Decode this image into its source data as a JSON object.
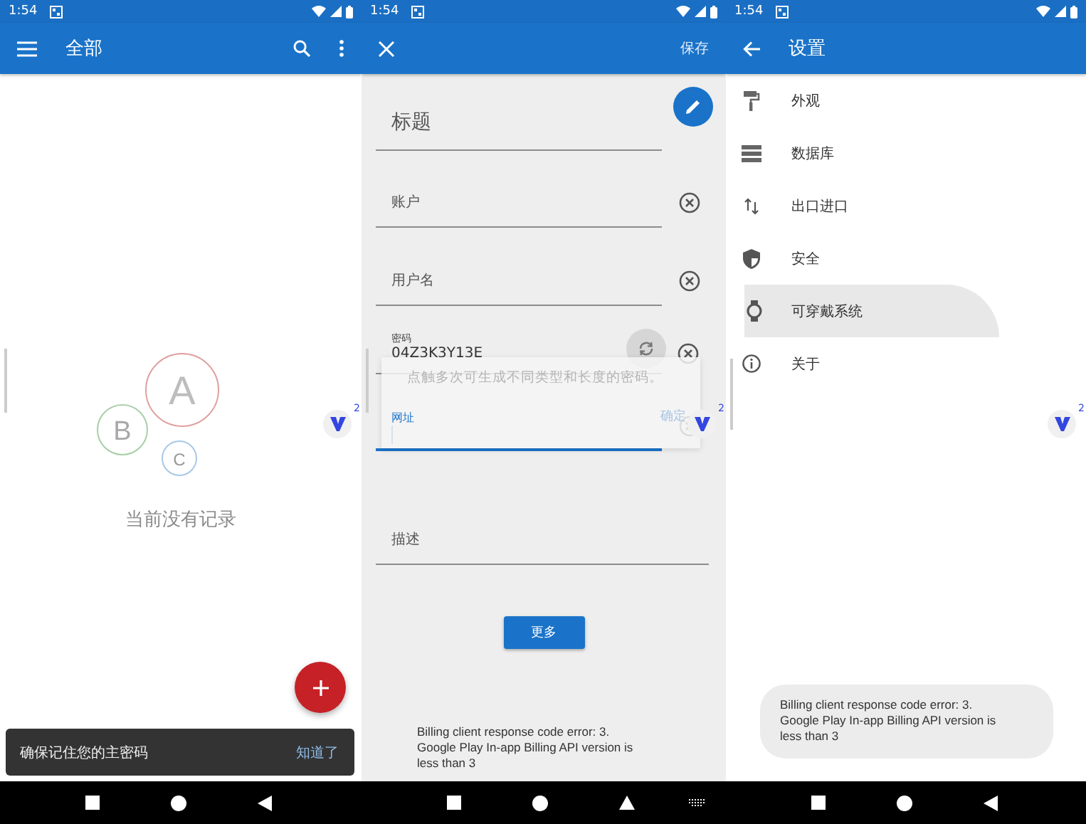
{
  "list_screen": {
    "status_bar": {
      "time": "1:54"
    },
    "app_bar": {
      "title": "全部"
    },
    "empty_state": {
      "letters": [
        "A",
        "B",
        "C"
      ],
      "message": "当前没有记录"
    },
    "bubble": {
      "badge": "2"
    },
    "snackbar": {
      "message": "确保记住您的主密码",
      "action": "知道了"
    }
  },
  "edit_screen": {
    "status_bar": {
      "time": "1:54"
    },
    "app_bar": {
      "action": "保存"
    },
    "fields": [
      {
        "kind": "title",
        "label": "标题",
        "focused": false
      },
      {
        "kind": "clearable",
        "label": "账户",
        "focused": false
      },
      {
        "kind": "clearable",
        "label": "用户名",
        "focused": false
      },
      {
        "kind": "password",
        "label": "密码",
        "value": "04Z3K3Y13E",
        "focused": false
      },
      {
        "kind": "clearable",
        "label": "网址",
        "focused": true
      },
      {
        "kind": "plain",
        "label": "描述",
        "focused": false
      }
    ],
    "tooltip": {
      "text": "点触多次可生成不同类型和长度的密码。",
      "action": "确定"
    },
    "bubble": {
      "badge": "2"
    },
    "more_button": "更多",
    "toast": "Billing client response code error: 3. Google Play In-app Billing API version is less than 3"
  },
  "settings_screen": {
    "status_bar": {
      "time": "1:54"
    },
    "app_bar": {
      "title": "设置"
    },
    "items": [
      {
        "label": "外观",
        "selected": false
      },
      {
        "label": "数据库",
        "selected": false
      },
      {
        "label": "出口进口",
        "selected": false
      },
      {
        "label": "安全",
        "selected": false
      },
      {
        "label": "可穿戴系统",
        "selected": true
      },
      {
        "label": "关于",
        "selected": false
      }
    ],
    "bubble": {
      "badge": "2"
    },
    "toast": "Billing client response code error: 3. Google Play In-app Billing API version is less than 3"
  }
}
